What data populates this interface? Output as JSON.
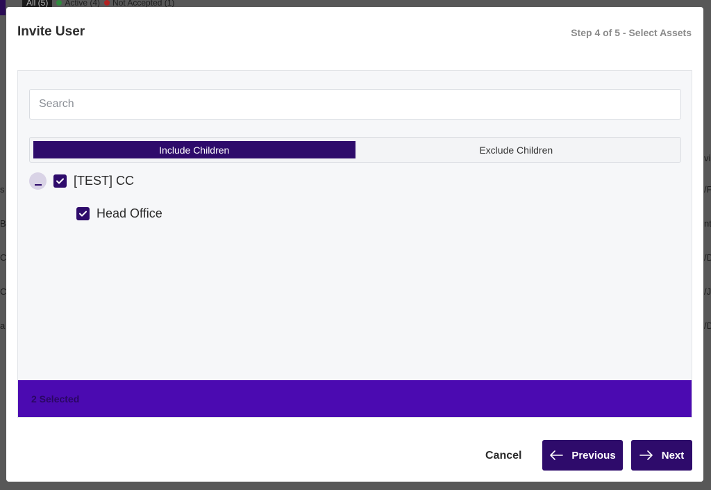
{
  "background": {
    "filters": [
      {
        "label": "All (5)"
      },
      {
        "label": "Active (4)",
        "dot_color": "#2e8b3e"
      },
      {
        "label": "Not Accepted (1)",
        "dot_color": "#b22222"
      }
    ],
    "right_fragments": [
      "vi",
      "/F",
      "nt",
      "/D",
      "/J",
      "/D"
    ],
    "left_fragments": [
      "s",
      "B",
      "C",
      "C",
      "a"
    ]
  },
  "modal": {
    "title": "Invite User",
    "step": "Step 4 of 5 - Select Assets",
    "search": {
      "placeholder": "Search",
      "value": ""
    },
    "toggle": {
      "options": [
        "Include Children",
        "Exclude Children"
      ],
      "selected": "Include Children"
    },
    "tree": [
      {
        "label": "[TEST] CC",
        "checked": true,
        "expanded": true,
        "level": 0
      },
      {
        "label": "Head Office",
        "checked": true,
        "level": 1
      }
    ],
    "selected_count": "2 Selected",
    "footer": {
      "cancel_label": "Cancel",
      "previous_label": "Previous",
      "next_label": "Next"
    }
  },
  "colors": {
    "primary": "#2e0b6b",
    "selected_bar": "#4b0ab1",
    "collapse_bg": "#d9d3e6"
  },
  "icons": [
    "minus-icon",
    "check-icon",
    "arrow-left-icon",
    "arrow-right-icon"
  ]
}
